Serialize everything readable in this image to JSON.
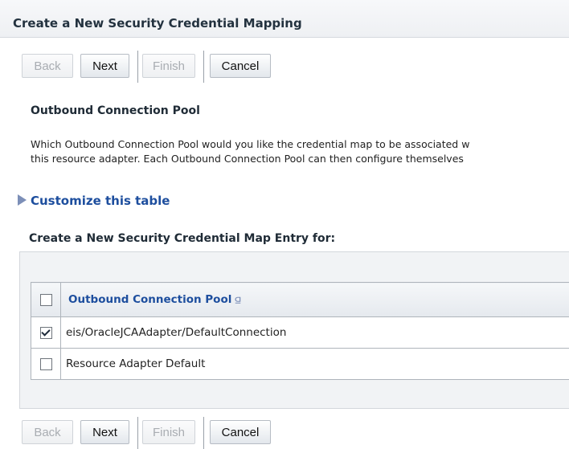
{
  "page": {
    "title": "Create a New Security Credential Mapping"
  },
  "toolbar_top": {
    "back": "Back",
    "next": "Next",
    "finish": "Finish",
    "cancel": "Cancel"
  },
  "section": {
    "heading": "Outbound Connection Pool",
    "desc_line1": "Which Outbound Connection Pool would you like the credential map to be associated w",
    "desc_line2": "this resource adapter. Each Outbound Connection Pool can then configure themselves"
  },
  "customize": {
    "label": "Customize this table",
    "icon": "expand-triangle-icon"
  },
  "map_entry": {
    "heading": "Create a New Security Credential Map Entry for:"
  },
  "table": {
    "column_header": "Outbound Connection Pool",
    "sort_icon": "sort-ascending-icon",
    "rows": [
      {
        "label": "eis/OracleJCAAdapter/DefaultConnection",
        "checked": true
      },
      {
        "label": "Resource Adapter Default",
        "checked": false
      }
    ]
  },
  "toolbar_bottom": {
    "back": "Back",
    "next": "Next",
    "finish": "Finish",
    "cancel": "Cancel"
  }
}
